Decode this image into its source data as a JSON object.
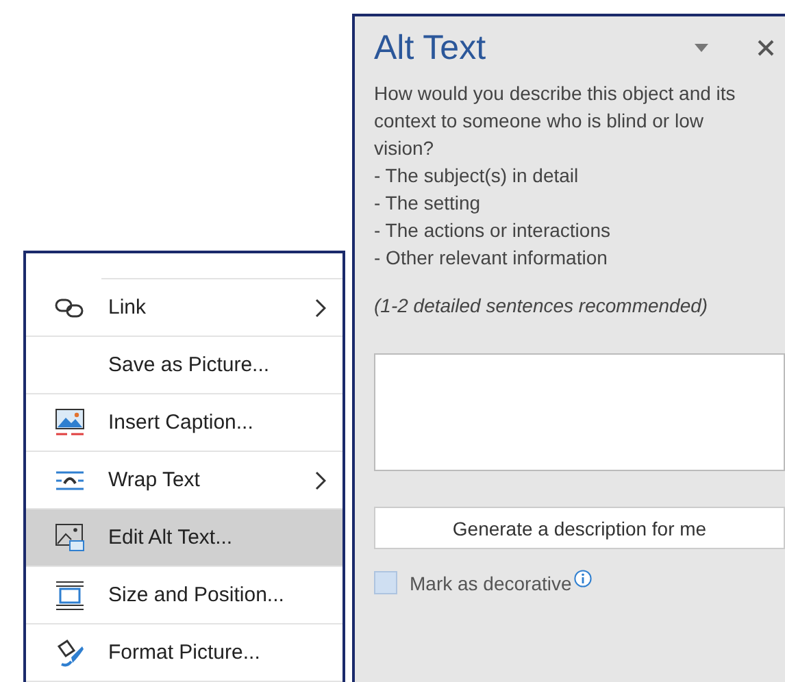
{
  "context_menu": {
    "items": [
      {
        "label": "Link",
        "kind": "link",
        "submenu": true,
        "selected": false
      },
      {
        "label": "Save as Picture...",
        "kind": "plain",
        "submenu": false,
        "selected": false
      },
      {
        "label": "Insert Caption...",
        "kind": "caption",
        "submenu": false,
        "selected": false
      },
      {
        "label": "Wrap Text",
        "kind": "wrap",
        "submenu": true,
        "selected": false
      },
      {
        "label": "Edit Alt Text...",
        "kind": "alt",
        "submenu": false,
        "selected": true
      },
      {
        "label": "Size and Position...",
        "kind": "size",
        "submenu": false,
        "selected": false
      },
      {
        "label": "Format Picture...",
        "kind": "format",
        "submenu": false,
        "selected": false
      }
    ]
  },
  "alt_text_pane": {
    "title": "Alt Text",
    "prompt": "How would you describe this object and its context to someone who is blind or low vision?",
    "bullets": [
      "- The subject(s) in detail",
      "- The setting",
      "- The actions or interactions",
      "- Other relevant information"
    ],
    "hint": "(1-2 detailed sentences recommended)",
    "generate_button": "Generate a description for me",
    "decorative": {
      "label": "Mark as decorative",
      "checked": false
    }
  }
}
